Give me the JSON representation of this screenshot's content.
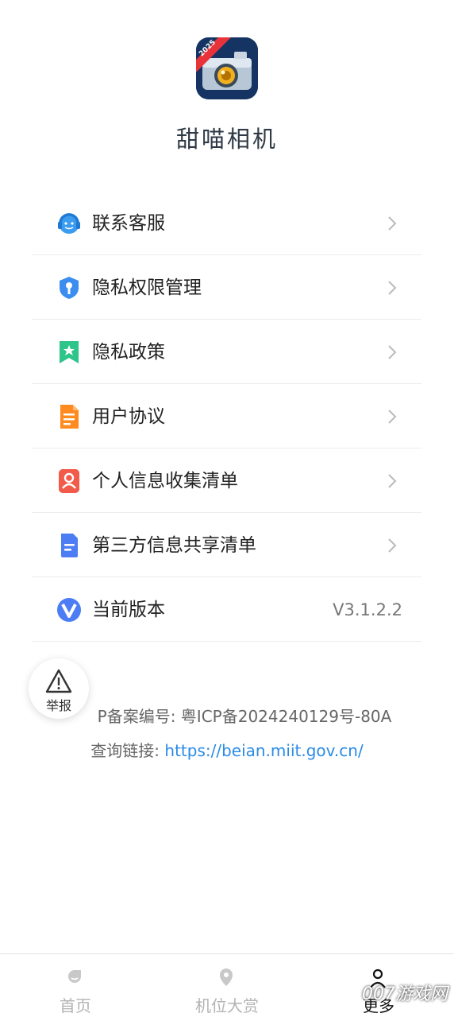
{
  "app": {
    "name": "甜喵相机",
    "logo_badge": "2025"
  },
  "menu": {
    "items": [
      {
        "label": "联系客服",
        "icon": "headset-icon",
        "color": "#3b9cf0"
      },
      {
        "label": "隐私权限管理",
        "icon": "shield-key-icon",
        "color": "#3b8ef0"
      },
      {
        "label": "隐私政策",
        "icon": "bookmark-star-icon",
        "color": "#2ec48a"
      },
      {
        "label": "用户协议",
        "icon": "document-icon",
        "color": "#ff8a1f"
      },
      {
        "label": "个人信息收集清单",
        "icon": "user-card-icon",
        "color": "#f25a4a"
      },
      {
        "label": "第三方信息共享清单",
        "icon": "file-list-icon",
        "color": "#4d7df5"
      },
      {
        "label": "当前版本",
        "icon": "version-v-icon",
        "color": "#4d7df5",
        "value": "V3.1.2.2"
      }
    ]
  },
  "report": {
    "label": "举报"
  },
  "footer": {
    "icp_text": "P备案编号: 粤ICP备2024240129号-80A",
    "query_prefix": "查询链接: ",
    "query_link": "https://beian.miit.gov.cn/"
  },
  "tabbar": {
    "tabs": [
      {
        "label": "首页",
        "icon": "home-icon"
      },
      {
        "label": "机位大赏",
        "icon": "location-pin-icon"
      },
      {
        "label": "更多",
        "icon": "person-icon",
        "active": true
      }
    ]
  },
  "watermark": "007游戏网"
}
